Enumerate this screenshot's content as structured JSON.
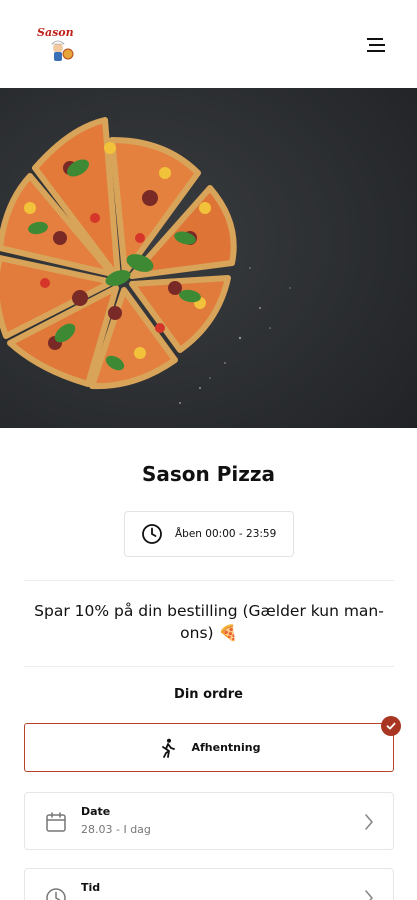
{
  "header": {
    "logo_text": "Sason",
    "logo_icon": "chef-pizza-logo",
    "menu_icon": "hamburger-menu-icon"
  },
  "hero": {
    "image": "pizza-photo"
  },
  "store": {
    "name": "Sason Pizza",
    "hours": "Åben 00:00 - 23:59",
    "hours_icon": "clock-icon"
  },
  "promo": {
    "text": "Spar 10% på din bestilling (Gælder kun man-ons) 🍕"
  },
  "order": {
    "heading": "Din ordre",
    "pickup_label": "Afhentning",
    "pickup_icon": "walking-person-icon",
    "date_label": "Date",
    "date_value": "28.03 - I dag",
    "time_label": "Tid",
    "time_value": ""
  },
  "colors": {
    "accent": "#a93623",
    "border_selected": "#b7432e",
    "divider": "#ececec"
  }
}
